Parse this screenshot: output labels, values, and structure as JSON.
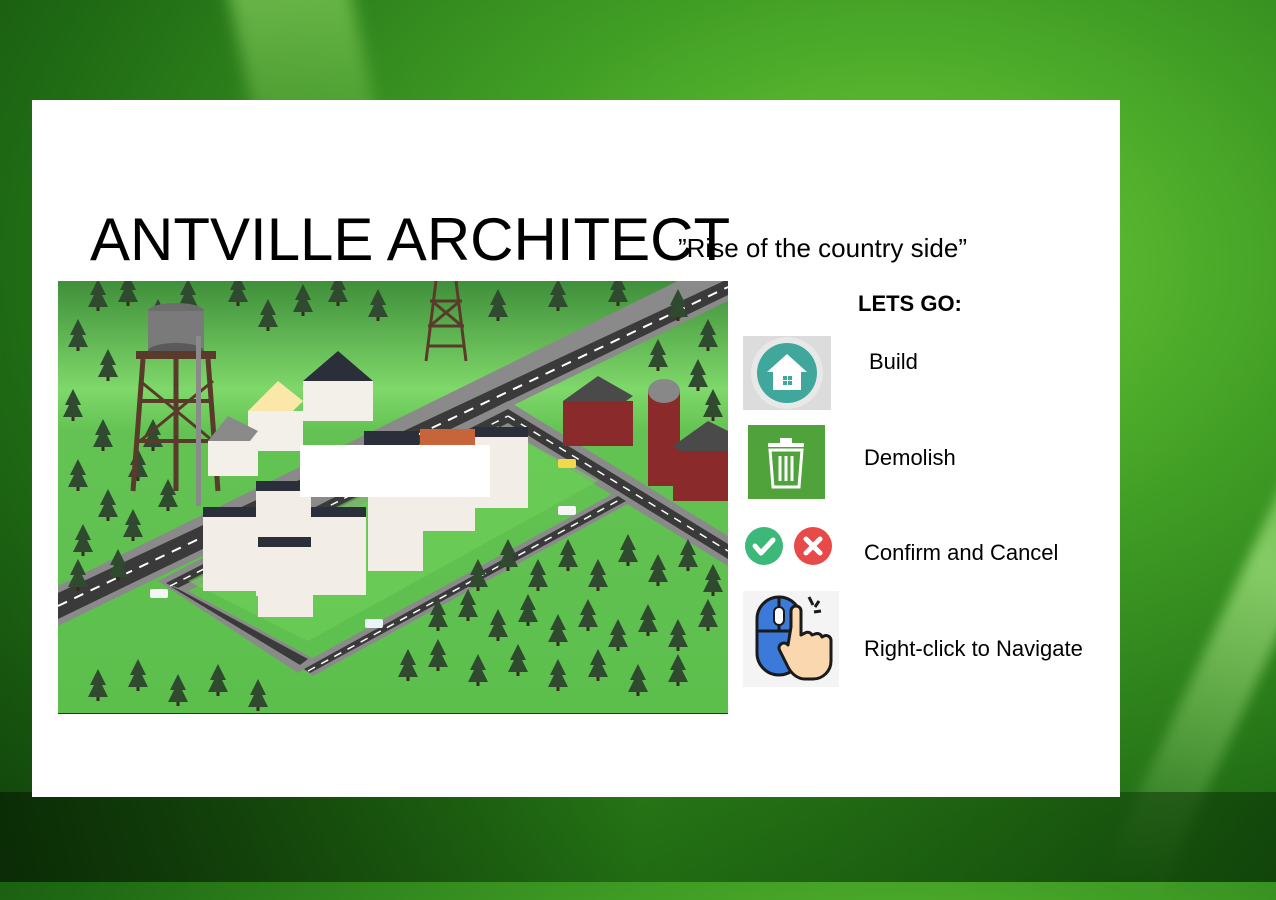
{
  "title": "ANTVILLE ARCHITECT",
  "subtitle": "”Rise of the country side”",
  "controls": {
    "heading": "LETS GO:",
    "build": {
      "label": "Build",
      "icon": "house-icon"
    },
    "demolish": {
      "label": "Demolish",
      "icon": "trash-icon"
    },
    "confirm_cancel": {
      "label": "Confirm and Cancel",
      "icons": [
        "check-icon",
        "cancel-icon"
      ]
    },
    "navigate": {
      "label": "Right-click to Navigate",
      "icon": "mouse-click-icon"
    }
  },
  "colors": {
    "build_teal": "#3fa79b",
    "demolish_green": "#4fa33a",
    "confirm_green": "#3cb878",
    "cancel_red": "#e84a4a",
    "mouse_blue": "#3b7ad8"
  }
}
